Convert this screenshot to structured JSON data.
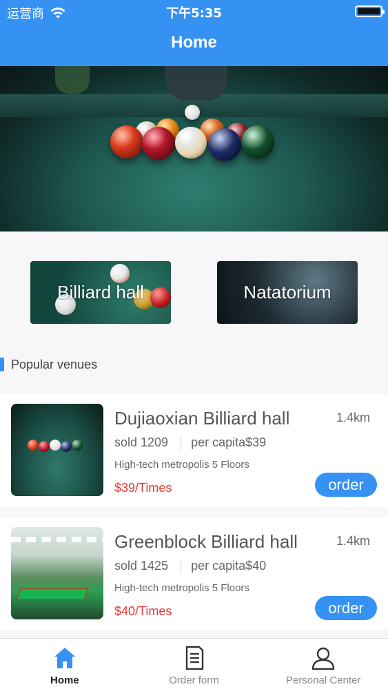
{
  "status_bar": {
    "carrier": "运营商",
    "time": "下午5:35"
  },
  "nav": {
    "title": "Home"
  },
  "categories": [
    {
      "label": "Billiard hall"
    },
    {
      "label": "Natatorium"
    }
  ],
  "section": {
    "title": "Popular venues"
  },
  "venues": [
    {
      "name": "Dujiaoxian Billiard hall",
      "distance": "1.4km",
      "sold": "sold 1209",
      "per_capita": "per capita$39",
      "address": "High-tech metropolis 5 Floors",
      "price": "$39/Times",
      "order_label": "order"
    },
    {
      "name": "Greenblock Billiard hall",
      "distance": "1.4km",
      "sold": "sold 1425",
      "per_capita": "per capita$40",
      "address": "High-tech metropolis 5 Floors",
      "price": "$40/Times",
      "order_label": "order"
    }
  ],
  "tabbar": {
    "items": [
      {
        "label": "Home",
        "icon": "home-icon",
        "active": true
      },
      {
        "label": "Order form",
        "icon": "document-icon",
        "active": false
      },
      {
        "label": "Personal Center",
        "icon": "person-icon",
        "active": false
      }
    ]
  },
  "colors": {
    "primary": "#3592f3",
    "price": "#e53935"
  }
}
